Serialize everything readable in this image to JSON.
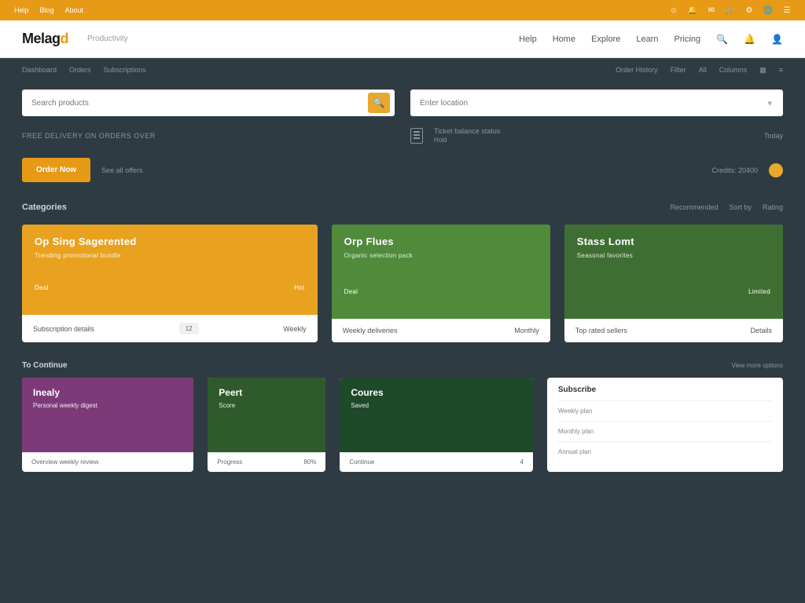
{
  "colors": {
    "accent": "#e79a16",
    "bg": "#2f3b43",
    "green": "#4f8b3b",
    "purple": "#7c3b78"
  },
  "topbar": {
    "left": [
      "Help",
      "Blog",
      "About"
    ],
    "right_icons": [
      "user-icon",
      "bell-icon",
      "mail-icon",
      "cart-icon",
      "gear-icon",
      "globe-icon",
      "menu-icon"
    ]
  },
  "navbar": {
    "logo_main": "Melag",
    "logo_accent": "d",
    "subtitle": "Productivity",
    "links": [
      "Help",
      "Home",
      "Explore",
      "Learn",
      "Pricing"
    ],
    "icons": [
      "search-icon",
      "bell-icon",
      "user-icon"
    ]
  },
  "crumbs": {
    "left": [
      "Dashboard",
      "Orders",
      "Subscriptions"
    ],
    "right": [
      "Order History",
      "Filter",
      "All",
      "Columns"
    ],
    "right_icons": [
      "grid-icon",
      "list-icon"
    ]
  },
  "search": {
    "left_placeholder": "Search products",
    "right_placeholder": "Enter location"
  },
  "info": {
    "left_label": "Free delivery on orders over",
    "cta": "Order Now",
    "cta_caption": "See all offers",
    "right_label": "Ticket balance status",
    "right_sub": "Hold",
    "right_end": "Today",
    "right_credit": "Credits: 20400"
  },
  "section": {
    "title": "Categories",
    "right": [
      "Recommended",
      "Sort by",
      "Rating"
    ]
  },
  "cards": [
    {
      "color": "c-orange",
      "title": "Op Sing Sagerented",
      "sub": "Trending promotional bundle",
      "bl": "Deal",
      "br": "Hot",
      "foot_l": "Subscription details",
      "foot_chip": "12",
      "foot_r": "Weekly"
    },
    {
      "color": "c-green",
      "title": "Orp Flues",
      "sub": "Organic selection pack",
      "bl": "Deal",
      "br": "",
      "foot_l": "Weekly deliveries",
      "foot_chip": "",
      "foot_r": "Monthly"
    },
    {
      "color": "c-green2",
      "title": "Stass Lomt",
      "sub": "Seasonal favorites",
      "bl": "",
      "br": "Limited",
      "foot_l": "Top rated sellers",
      "foot_chip": "",
      "foot_r": "Details"
    }
  ],
  "row2head": {
    "title": "To Continue",
    "right": "View more options"
  },
  "cards2": {
    "a": {
      "color": "c-purple",
      "title": "Inealy",
      "sub": "Personal weekly digest",
      "foot_l": "Overview weekly review",
      "foot_r": ""
    },
    "b": {
      "color": "c-green3",
      "title": "Peert",
      "sub": "Score",
      "foot_l": "Progress",
      "foot_r": "80%"
    },
    "c": {
      "color": "c-dgreen",
      "title": "Coures",
      "sub": "Saved",
      "foot_l": "Continue",
      "foot_r": "4"
    },
    "panel": {
      "title": "Subscribe",
      "rows": [
        [
          "Weekly plan",
          ""
        ],
        [
          "Monthly plan",
          ""
        ],
        [
          "Annual plan",
          ""
        ]
      ]
    }
  }
}
